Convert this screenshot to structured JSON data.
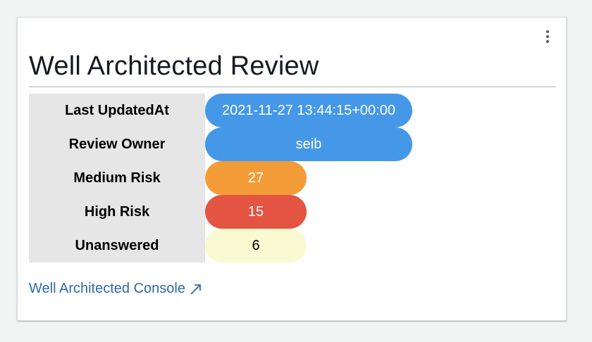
{
  "widget": {
    "title": "Well Architected Review",
    "rows": [
      {
        "label": "Last UpdatedAt",
        "value": "2021-11-27 13:44:15+00:00",
        "color": "#4598e8",
        "text_color": "#ffffff"
      },
      {
        "label": "Review Owner",
        "value": "seib",
        "color": "#4598e8",
        "text_color": "#ffffff"
      },
      {
        "label": "Medium Risk",
        "value": "27",
        "color": "#f39c38",
        "text_color": "#ffffff"
      },
      {
        "label": "High Risk",
        "value": "15",
        "color": "#e35442",
        "text_color": "#ffffff"
      },
      {
        "label": "Unanswered",
        "value": "6",
        "color": "#fafad2",
        "text_color": "#000000"
      }
    ],
    "link": {
      "label": "Well Architected Console",
      "icon": "external-link-icon"
    },
    "menu_icon": "vertical-ellipsis-icon"
  }
}
